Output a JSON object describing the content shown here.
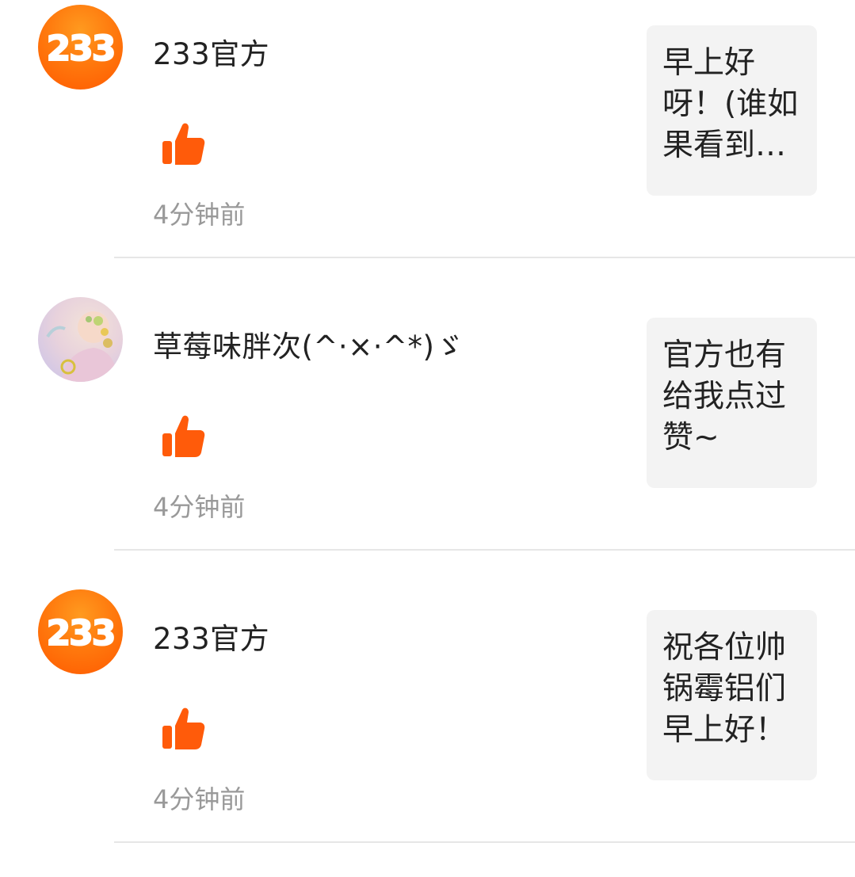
{
  "notifications": [
    {
      "username": "233官方",
      "avatar": "official-233-logo",
      "logo_text": "233",
      "like_icon": "thumbs-up-icon",
      "time": "4分钟前",
      "comment": "早上好呀！(谁如果看到…"
    },
    {
      "username": "草莓味胖次(^·×·^*)ゞ",
      "avatar": "user-illustration-avatar",
      "like_icon": "thumbs-up-icon",
      "time": "4分钟前",
      "comment": "官方也有给我点过赞~"
    },
    {
      "username": "233官方",
      "avatar": "official-233-logo",
      "logo_text": "233",
      "like_icon": "thumbs-up-icon",
      "time": "4分钟前",
      "comment": "祝各位帅锅霉铝们早上好！"
    }
  ],
  "colors": {
    "accent": "#ff5a00",
    "like": "#ff5b0a",
    "text": "#222222",
    "muted": "#999999",
    "bubble": "#f3f3f3",
    "divider": "#e6e6e6"
  }
}
